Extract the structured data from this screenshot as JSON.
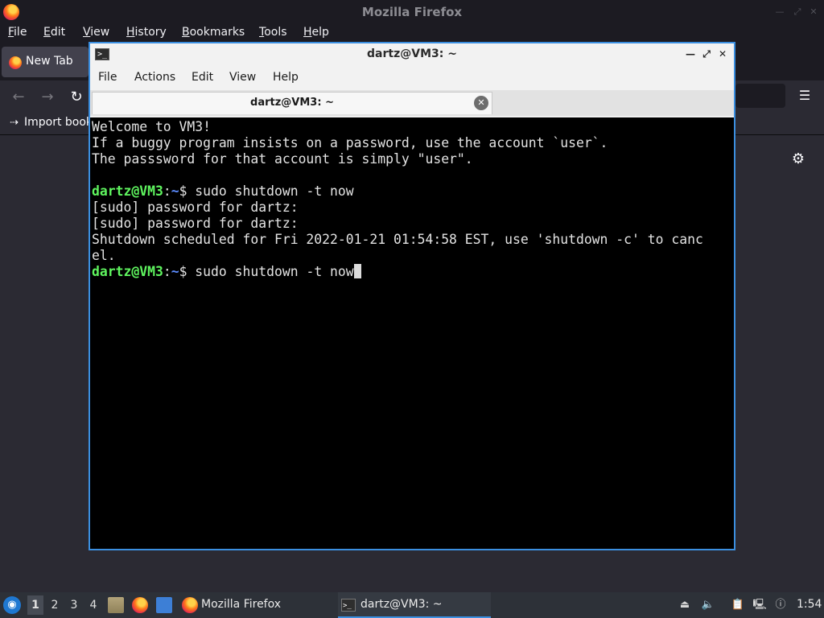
{
  "firefox": {
    "title": "Mozilla Firefox",
    "menu": [
      {
        "label": "File",
        "key": "F",
        "rest": "ile"
      },
      {
        "label": "Edit",
        "key": "E",
        "rest": "dit"
      },
      {
        "label": "View",
        "key": "V",
        "rest": "iew"
      },
      {
        "label": "History",
        "key": "H",
        "rest": "istory"
      },
      {
        "label": "Bookmarks",
        "key": "B",
        "rest": "ookmarks"
      },
      {
        "label": "Tools",
        "key": "T",
        "rest": "ools"
      },
      {
        "label": "Help",
        "key": "H",
        "rest": "elp"
      }
    ],
    "tab_label": "New Tab",
    "import_label": "Import book"
  },
  "terminal": {
    "title": "dartz@VM3: ~",
    "menu": [
      "File",
      "Actions",
      "Edit",
      "View",
      "Help"
    ],
    "tab_label": "dartz@VM3: ~",
    "prompt_user": "dartz@VM3",
    "prompt_path": "~",
    "lines": [
      "Welcome to VM3!",
      "If a buggy program insists on a password, use the account `user`.",
      "The passsword for that account is simply \"user\".",
      "",
      "$PROMPT sudo shutdown -t now",
      "[sudo] password for dartz:",
      "[sudo] password for dartz:",
      "Shutdown scheduled for Fri 2022-01-21 01:54:58 EST, use 'shutdown -c' to canc",
      "el.",
      "$PROMPT sudo shutdown -t now"
    ]
  },
  "taskbar": {
    "workspaces": [
      "1",
      "2",
      "3",
      "4"
    ],
    "active_workspace": "1",
    "tasks": [
      {
        "label": "Mozilla Firefox",
        "icon": "firefox-icon"
      },
      {
        "label": "dartz@VM3: ~",
        "icon": "terminal-icon"
      }
    ],
    "clock": "1:54"
  }
}
